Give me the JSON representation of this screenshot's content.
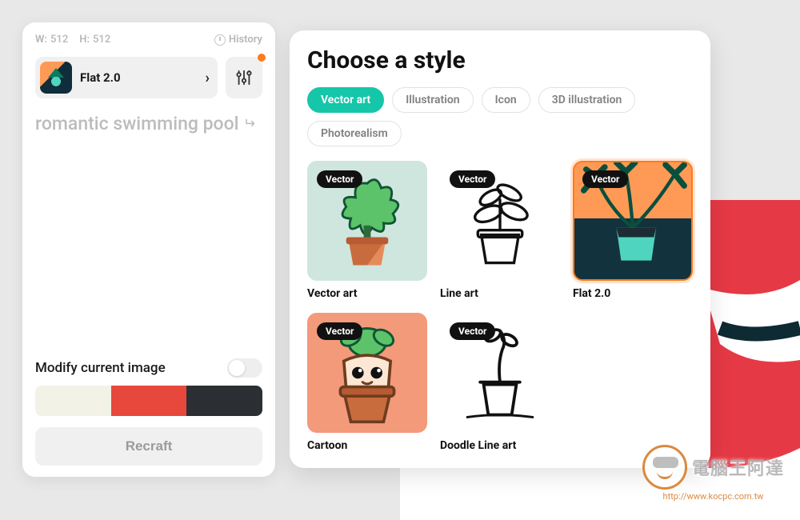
{
  "dims": {
    "w_label": "W:",
    "w": "512",
    "h_label": "H:",
    "h": "512"
  },
  "history_label": "History",
  "current_style": "Flat 2.0",
  "prompt": "romantic swimming pool",
  "modify_label": "Modify current image",
  "palette": [
    "#f3f2e7",
    "#e6483b",
    "#2b2f33"
  ],
  "recraft_label": "Recraft",
  "panel": {
    "title": "Choose a style",
    "filters": [
      "Vector art",
      "Illustration",
      "Icon",
      "3D illustration",
      "Photorealism"
    ],
    "active_filter": "Vector art",
    "badge": "Vector",
    "styles": [
      {
        "name": "Vector art",
        "selected": false
      },
      {
        "name": "Line art",
        "selected": false
      },
      {
        "name": "Flat 2.0",
        "selected": true
      },
      {
        "name": "Cartoon",
        "selected": false
      },
      {
        "name": "Doodle Line art",
        "selected": false
      }
    ]
  },
  "watermark": {
    "text": "電腦王阿達",
    "url": "http://www.kocpc.com.tw"
  }
}
